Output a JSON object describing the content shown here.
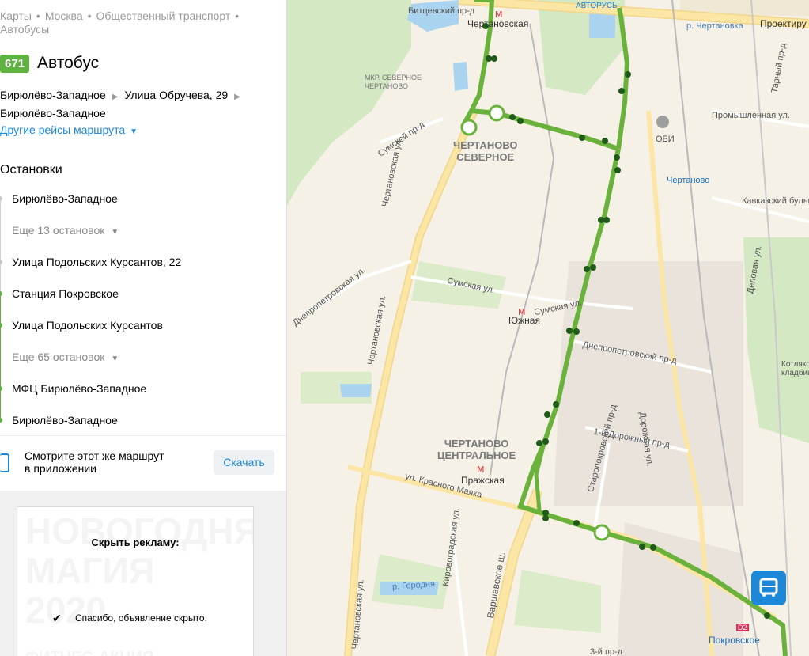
{
  "breadcrumbs": [
    "Карты",
    "Москва",
    "Общественный транспорт",
    "Автобусы"
  ],
  "route": {
    "number": "671",
    "type_label": "Автобус"
  },
  "direction": {
    "from": "Бирюлёво-Западное",
    "via": "Улица Обручева, 29",
    "to": "Бирюлёво-Западное"
  },
  "other_trips_label": "Другие рейсы маршрута",
  "stops_header": "Остановки",
  "stops": [
    {
      "label": "Бирюлёво-Западное",
      "kind": "stop",
      "color": "grey"
    },
    {
      "label": "Еще 13 остановок",
      "kind": "more",
      "color": "grey"
    },
    {
      "label": "Улица Подольских Курсантов, 22",
      "kind": "stop",
      "color": "grey"
    },
    {
      "label": "Станция Покровское",
      "kind": "stop",
      "color": "green"
    },
    {
      "label": "Улица Подольских Курсантов",
      "kind": "stop",
      "color": "green"
    },
    {
      "label": "Еще 65 остановок",
      "kind": "more",
      "color": "green"
    },
    {
      "label": "МФЦ Бирюлёво-Западное",
      "kind": "stop",
      "color": "green"
    },
    {
      "label": "Бирюлёво-Западное",
      "kind": "stop",
      "color": "green"
    }
  ],
  "app_promo": {
    "text_line1": "Смотрите этот же маршрут",
    "text_line2": "в приложении",
    "button": "Скачать"
  },
  "ad": {
    "hide_title": "Скрыть рекламу:",
    "thanks": "Спасибо, объявление скрыто.",
    "ghost_line1": "НОВОГОДНЯЯ",
    "ghost_line2": "МАГИЯ",
    "ghost_line3": "2020",
    "ghost_line4": "ФИТНЕС-АКЦИЯ"
  },
  "map": {
    "districts": [
      "ЧЕРТАНОВО\nСЕВЕРНОЕ",
      "ЧЕРТАНОВО\nЦЕНТРАЛЬНОЕ",
      "МКР. СЕВЕРНОЕ\nЧЕРТАНОВО"
    ],
    "stations": [
      "Чертановская",
      "Южная",
      "Пражская",
      "Чертаново",
      "Покровское",
      "ОБИ",
      "АВТОРУСЬ",
      "Котляковское кладбище"
    ],
    "streets": [
      "Битцевский пр-д",
      "Сумской пр-д",
      "Чертановская ул.",
      "Сумская ул.",
      "Днепропетровская ул.",
      "Днепропетровский пр-д",
      "ул. Красного Маяка",
      "Кировоградская ул.",
      "Варшавское ш.",
      "Старопокровский пр-д",
      "1-й Дорожный пр-д",
      "Дорожная ул.",
      "Промышленная ул.",
      "Кавказский бульв.",
      "Деловая ул.",
      "Тарный пр-д",
      "р. Чертановка",
      "р. Городня",
      "Проектиру",
      "3-й пр-д",
      "D2"
    ],
    "route_color": "#6ab23c",
    "stop_color": "#1f5a1a"
  }
}
